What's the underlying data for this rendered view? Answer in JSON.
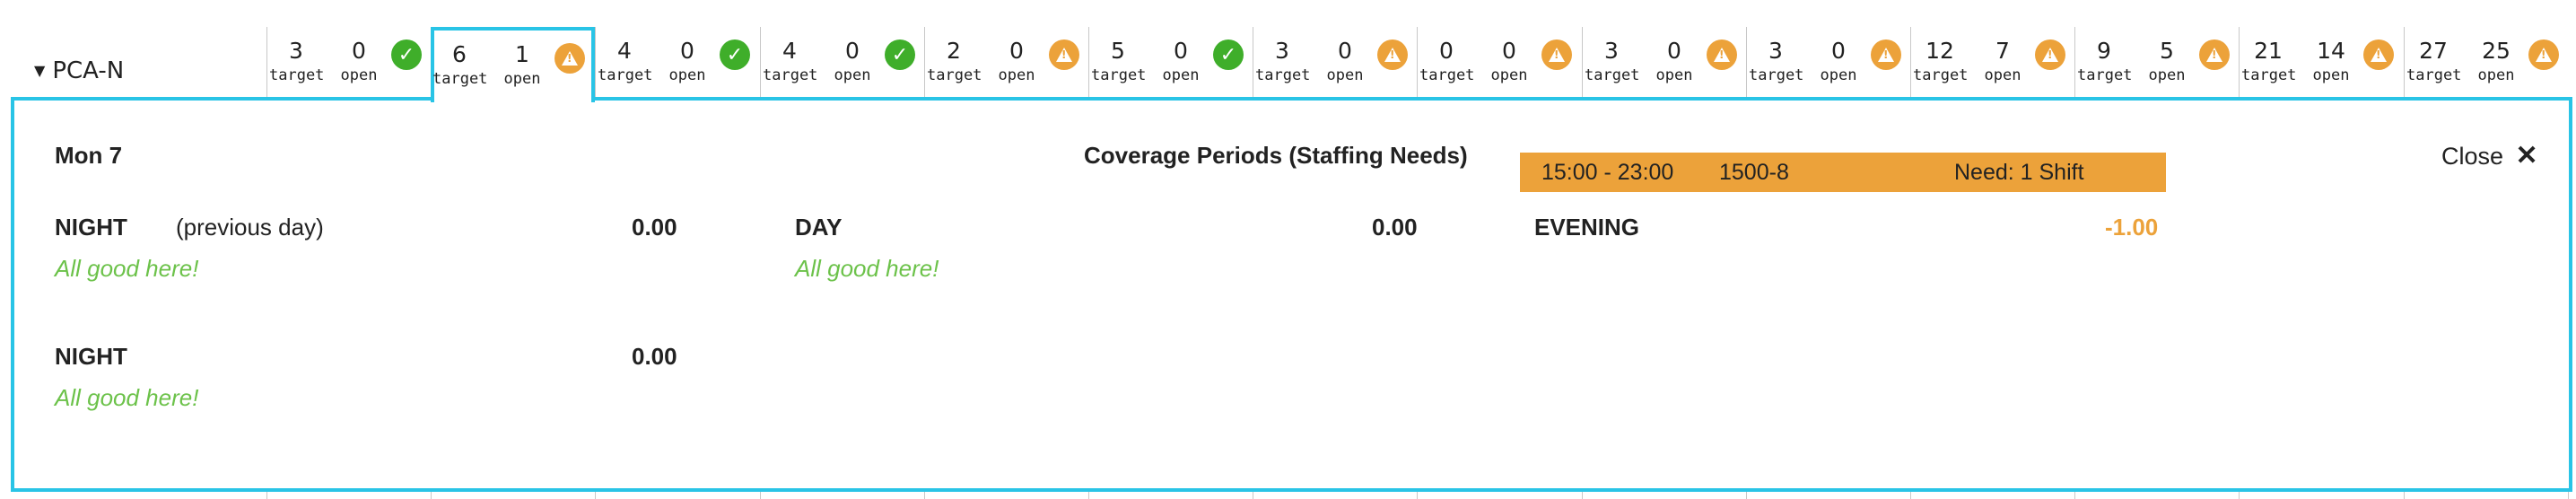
{
  "row": {
    "label": "PCA-N"
  },
  "cells": [
    {
      "target": "3",
      "open": "0",
      "status": "ok"
    },
    {
      "target": "6",
      "open": "1",
      "status": "warn"
    },
    {
      "target": "4",
      "open": "0",
      "status": "ok"
    },
    {
      "target": "4",
      "open": "0",
      "status": "ok"
    },
    {
      "target": "2",
      "open": "0",
      "status": "warn"
    },
    {
      "target": "5",
      "open": "0",
      "status": "ok"
    },
    {
      "target": "3",
      "open": "0",
      "status": "warn"
    },
    {
      "target": "0",
      "open": "0",
      "status": "warn"
    },
    {
      "target": "3",
      "open": "0",
      "status": "warn"
    },
    {
      "target": "3",
      "open": "0",
      "status": "warn"
    },
    {
      "target": "12",
      "open": "7",
      "status": "warn"
    },
    {
      "target": "9",
      "open": "5",
      "status": "warn"
    },
    {
      "target": "21",
      "open": "14",
      "status": "warn"
    },
    {
      "target": "27",
      "open": "25",
      "status": "warn"
    }
  ],
  "cell_labels": {
    "target": "target",
    "open": "open"
  },
  "panel": {
    "date": "Mon 7",
    "title": "Coverage Periods (Staffing Needs)",
    "close_label": "Close",
    "periods": {
      "night_prev": {
        "name": "NIGHT",
        "note": "(previous day)",
        "value": "0.00",
        "status": "All good here!"
      },
      "day": {
        "name": "DAY",
        "value": "0.00",
        "status": "All good here!"
      },
      "evening": {
        "name": "EVENING",
        "value": "-1.00"
      },
      "night": {
        "name": "NIGHT",
        "value": "0.00",
        "status": "All good here!"
      }
    },
    "shift": {
      "time": "15:00 - 23:00",
      "code": "1500-8",
      "need": "Need: 1 Shift"
    }
  },
  "colors": {
    "accent": "#29c4e6",
    "ok": "#3fae2a",
    "warn": "#eca23a",
    "good_text": "#6cc24a"
  }
}
